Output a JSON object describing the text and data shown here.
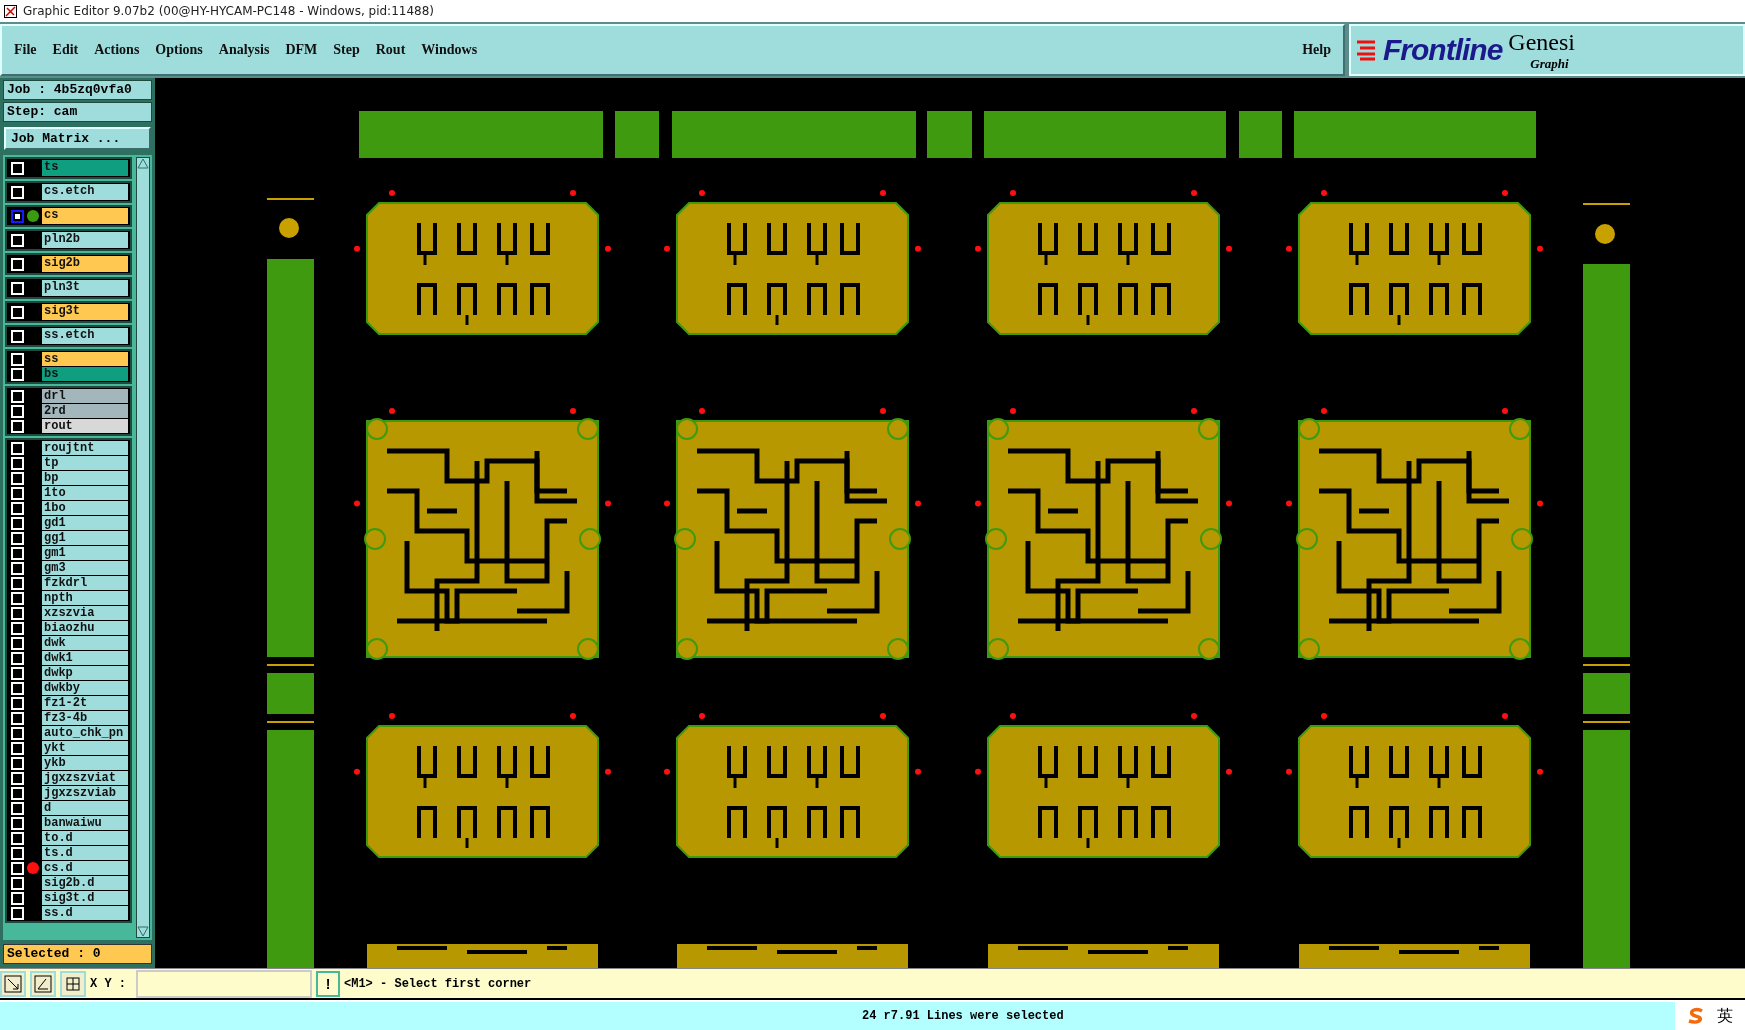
{
  "title_bar": {
    "title": "Graphic Editor 9.07b2 (00@HY-HYCAM-PC148 - Windows, pid:11488)"
  },
  "menu": [
    {
      "label": "File"
    },
    {
      "label": "Edit"
    },
    {
      "label": "Actions"
    },
    {
      "label": "Options"
    },
    {
      "label": "Analysis"
    },
    {
      "label": "DFM"
    },
    {
      "label": "Step"
    },
    {
      "label": "Rout"
    },
    {
      "label": "Windows"
    }
  ],
  "help": "Help",
  "logo": {
    "brand": "Frontline",
    "product": "Genesi",
    "subtitle": "Graphi"
  },
  "job": {
    "job": "Job : 4b5zq0vfa0",
    "step": "Step: cam",
    "matrix_button": "Job Matrix ..."
  },
  "layer_groups": [
    {
      "layers": [
        {
          "name": "ts",
          "color": "#0f9e80",
          "selected": false
        }
      ]
    },
    {
      "layers": [
        {
          "name": "cs.etch",
          "color": "#9fdcdc",
          "selected": false
        }
      ]
    },
    {
      "layers": [
        {
          "name": "cs",
          "color": "#ffc850",
          "selected": true,
          "dot": {
            "color": "#3a9a10"
          }
        }
      ]
    },
    {
      "layers": [
        {
          "name": "pln2b",
          "color": "#9fdcdc",
          "selected": false
        }
      ]
    },
    {
      "layers": [
        {
          "name": "sig2b",
          "color": "#ffc850",
          "selected": false
        }
      ]
    },
    {
      "layers": [
        {
          "name": "pln3t",
          "color": "#9fdcdc",
          "selected": false
        }
      ]
    },
    {
      "layers": [
        {
          "name": "sig3t",
          "color": "#ffc850",
          "selected": false
        }
      ]
    },
    {
      "layers": [
        {
          "name": "ss.etch",
          "color": "#9fdcdc",
          "selected": false
        }
      ]
    },
    {
      "layers": [
        {
          "name": "ss",
          "color": "#ffc850",
          "selected": false
        },
        {
          "name": "bs",
          "color": "#0f9e80",
          "selected": false
        }
      ]
    },
    {
      "layers": [
        {
          "name": "drl",
          "color": "#a3b6bc",
          "selected": false
        },
        {
          "name": "2rd",
          "color": "#a3b6bc",
          "selected": false
        },
        {
          "name": "rout",
          "color": "#d8d8d8",
          "selected": false
        }
      ]
    },
    {
      "layers": [
        {
          "name": "roujtnt",
          "color": "#9fdcdc",
          "selected": false
        },
        {
          "name": "tp",
          "color": "#9fdcdc",
          "selected": false
        },
        {
          "name": "bp",
          "color": "#9fdcdc",
          "selected": false
        },
        {
          "name": "1to",
          "color": "#9fdcdc",
          "selected": false
        },
        {
          "name": "1bo",
          "color": "#9fdcdc",
          "selected": false
        },
        {
          "name": "gd1",
          "color": "#9fdcdc",
          "selected": false
        },
        {
          "name": "gg1",
          "color": "#9fdcdc",
          "selected": false
        },
        {
          "name": "gm1",
          "color": "#9fdcdc",
          "selected": false
        },
        {
          "name": "gm3",
          "color": "#9fdcdc",
          "selected": false
        },
        {
          "name": "fzkdrl",
          "color": "#9fdcdc",
          "selected": false
        },
        {
          "name": "npth",
          "color": "#9fdcdc",
          "selected": false
        },
        {
          "name": "xzszvia",
          "color": "#9fdcdc",
          "selected": false
        },
        {
          "name": "biaozhu",
          "color": "#9fdcdc",
          "selected": false
        },
        {
          "name": "dwk",
          "color": "#9fdcdc",
          "selected": false
        },
        {
          "name": "dwk1",
          "color": "#9fdcdc",
          "selected": false
        },
        {
          "name": "dwkp",
          "color": "#9fdcdc",
          "selected": false
        },
        {
          "name": "dwkby",
          "color": "#9fdcdc",
          "selected": false
        },
        {
          "name": "fz1-2t",
          "color": "#9fdcdc",
          "selected": false
        },
        {
          "name": "fz3-4b",
          "color": "#9fdcdc",
          "selected": false
        },
        {
          "name": "auto_chk_pn",
          "color": "#9fdcdc",
          "selected": false
        },
        {
          "name": "ykt",
          "color": "#9fdcdc",
          "selected": false
        },
        {
          "name": "ykb",
          "color": "#9fdcdc",
          "selected": false
        },
        {
          "name": "jgxzszviat",
          "color": "#9fdcdc",
          "selected": false
        },
        {
          "name": "jgxzszviab",
          "color": "#9fdcdc",
          "selected": false
        },
        {
          "name": "d",
          "color": "#9fdcdc",
          "selected": false
        },
        {
          "name": "banwaiwu",
          "color": "#9fdcdc",
          "selected": false
        },
        {
          "name": "to.d",
          "color": "#9fdcdc",
          "selected": false
        },
        {
          "name": "ts.d",
          "color": "#9fdcdc",
          "selected": false
        },
        {
          "name": "cs.d",
          "color": "#9fdcdc",
          "selected": false,
          "dot": {
            "color": "#ff1010"
          }
        },
        {
          "name": "sig2b.d",
          "color": "#9fdcdc",
          "selected": false
        },
        {
          "name": "sig3t.d",
          "color": "#9fdcdc",
          "selected": false
        },
        {
          "name": "ss.d",
          "color": "#9fdcdc",
          "selected": false
        }
      ]
    }
  ],
  "selected_count": "Selected : 0",
  "toolbar": {
    "xy_label": "X Y :",
    "alert_button": "!",
    "prompt": "<M1> - Select first corner"
  },
  "status": "24 r7.91 Lines were selected",
  "tray": {
    "language": "英"
  }
}
